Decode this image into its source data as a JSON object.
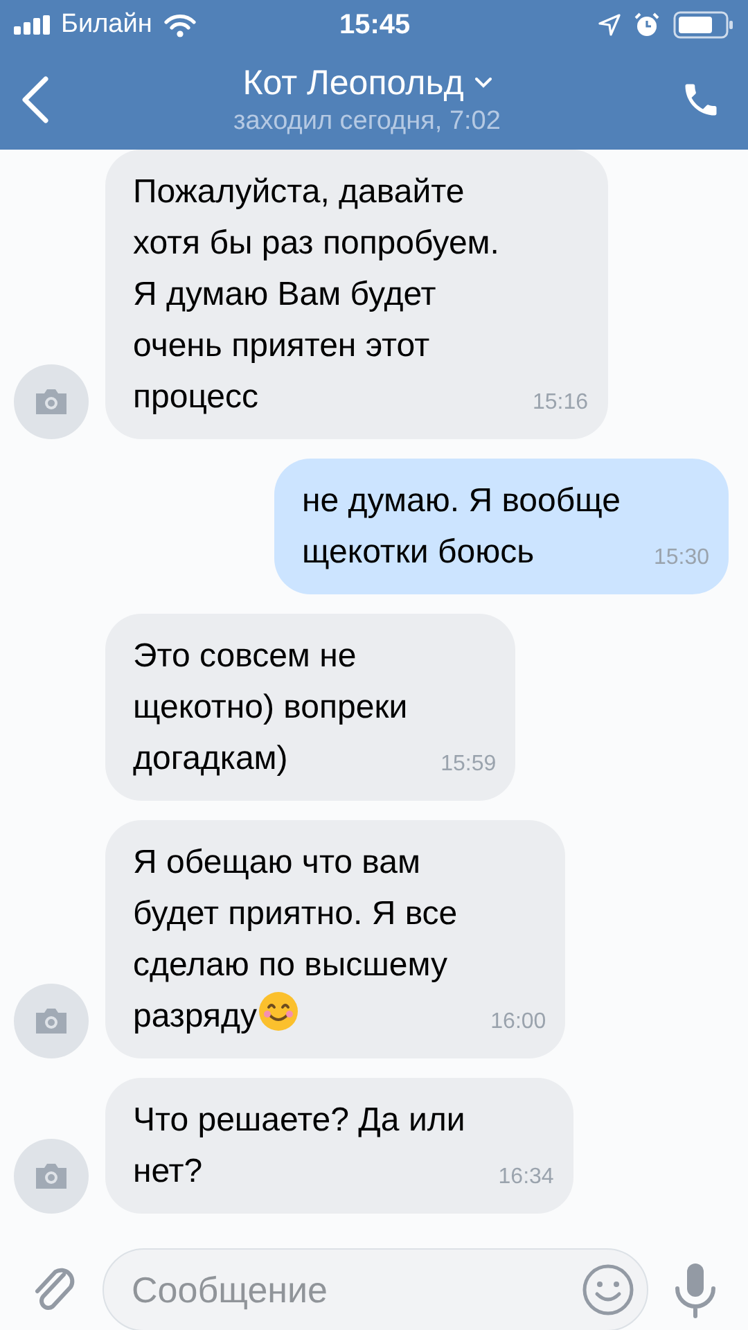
{
  "status_bar": {
    "carrier": "Билайн",
    "time": "15:45"
  },
  "header": {
    "title": "Кот Леопольд",
    "subtitle": "заходил сегодня, 7:02"
  },
  "messages": [
    {
      "kind": "incoming",
      "avatar": true,
      "text": "Пожалуйста, давайте\nхотя бы раз попробуем.\nЯ думаю Вам будет\nочень приятен этот\nпроцесс",
      "time": "15:16"
    },
    {
      "kind": "outgoing",
      "avatar": false,
      "text": "не думаю. Я вообще\nщекотки боюсь",
      "time": "15:30"
    },
    {
      "kind": "incoming",
      "avatar": false,
      "text": "Это совсем не\nщекотно) вопреки\nдогадкам)",
      "time": "15:59"
    },
    {
      "kind": "incoming",
      "avatar": true,
      "text": "Я обещаю что вам\nбудет приятно. Я все\nсделаю по высшему\nразряду",
      "smiley": true,
      "time": "16:00"
    },
    {
      "kind": "incoming",
      "avatar": true,
      "text": "Что решаете? Да или\nнет?",
      "time": "16:34"
    }
  ],
  "composer": {
    "placeholder": "Сообщение"
  }
}
